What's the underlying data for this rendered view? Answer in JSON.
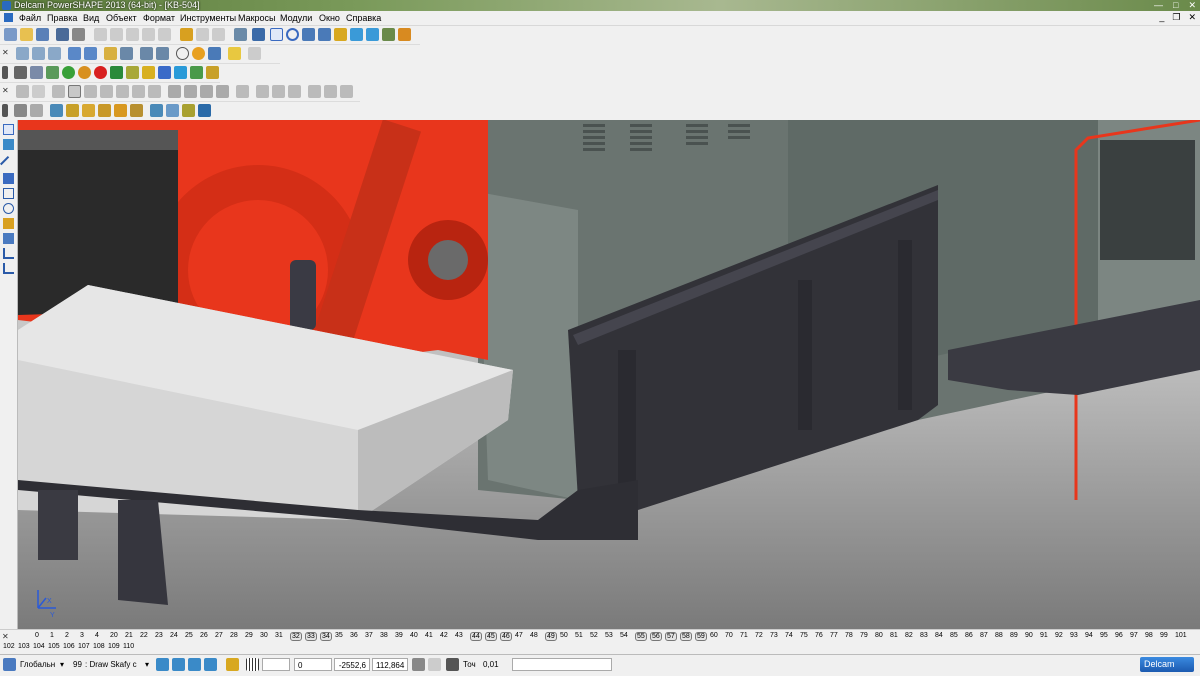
{
  "window": {
    "title": "Delcam PowerSHAPE 2013 (64-bit) - [KB-504]",
    "minimize": "—",
    "maximize": "□",
    "close": "✕"
  },
  "menu": [
    "Файл",
    "Правка",
    "Вид",
    "Объект",
    "Формат",
    "Инструменты",
    "Макросы",
    "Модули",
    "Окно",
    "Справка"
  ],
  "mdi": {
    "minimize": "_",
    "restore": "❐",
    "close": "✕"
  },
  "levels": {
    "row1": [
      "0",
      "1",
      "2",
      "3",
      "4",
      "20",
      "21",
      "22",
      "23",
      "24",
      "25",
      "26",
      "27",
      "28",
      "29",
      "30",
      "31",
      "32",
      "33",
      "34",
      "35",
      "36",
      "37",
      "38",
      "39",
      "40",
      "41",
      "42",
      "43",
      "44",
      "45",
      "46",
      "47",
      "48",
      "49",
      "50",
      "51",
      "52",
      "53",
      "54",
      "55",
      "56",
      "57",
      "58",
      "59",
      "60",
      "70",
      "71",
      "72",
      "73",
      "74",
      "75",
      "76",
      "77",
      "78",
      "79",
      "80",
      "81",
      "82",
      "83",
      "84",
      "85",
      "86",
      "87",
      "88",
      "89",
      "90",
      "91",
      "92",
      "93",
      "94",
      "95",
      "96",
      "97",
      "98",
      "99",
      "101"
    ],
    "boxed": [
      "32",
      "33",
      "34",
      "44",
      "45",
      "46",
      "49",
      "55",
      "56",
      "57",
      "58",
      "59"
    ],
    "row2": [
      "102",
      "103",
      "104",
      "105",
      "106",
      "107",
      "108",
      "109",
      "110"
    ]
  },
  "status": {
    "workplane": "Глобальн",
    "level_num": "99",
    "level_name": ": Draw Skafy c",
    "x_val": "0",
    "y_val": "-2552,6",
    "z_val": "112,864",
    "tol_label": "Точ",
    "tol_val": "0,01",
    "brand": "Delcam"
  },
  "axis": {
    "x": "X",
    "y": "Y"
  },
  "colors": {
    "red": "#e8361c",
    "darkred": "#b82410",
    "gray_green": "#6a7470",
    "dark_steel": "#3a3a42",
    "light_block": "#d6d6d6"
  }
}
